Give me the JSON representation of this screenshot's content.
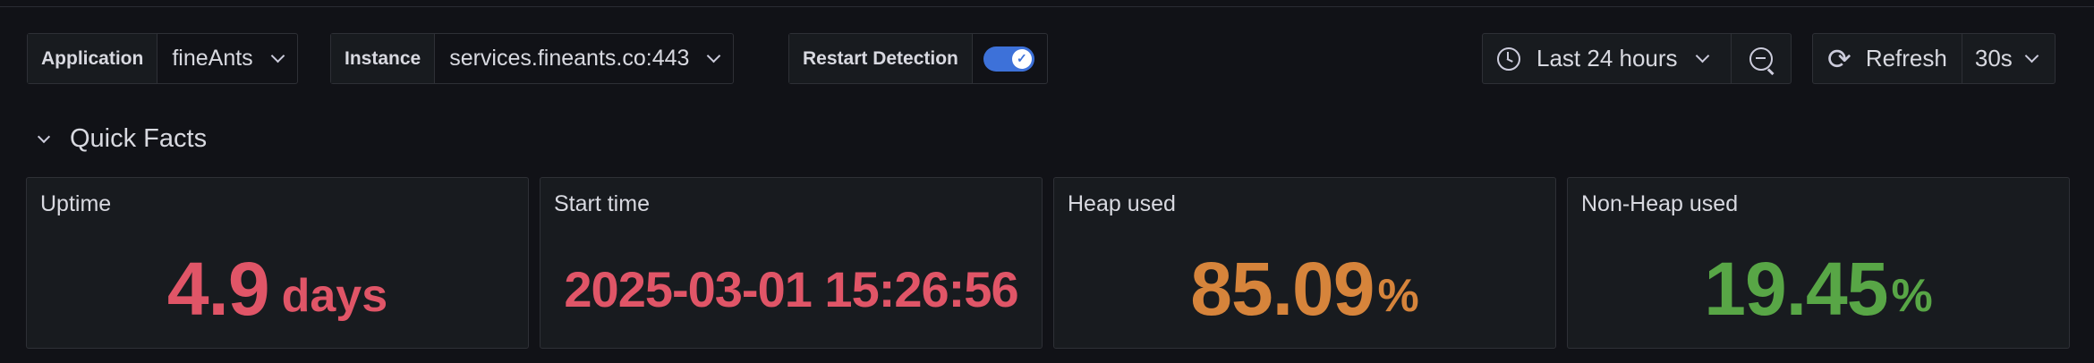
{
  "variables": {
    "application": {
      "label": "Application",
      "value": "fineAnts"
    },
    "instance": {
      "label": "Instance",
      "value": "services.fineants.co:443"
    },
    "restart_detection": {
      "label": "Restart Detection",
      "enabled": true
    }
  },
  "time_picker": {
    "range": "Last 24 hours"
  },
  "refresh": {
    "label": "Refresh",
    "interval": "30s"
  },
  "row": {
    "title": "Quick Facts",
    "collapsed": false
  },
  "panels": [
    {
      "title": "Uptime",
      "value": "4.9",
      "unit": "days",
      "color": "#e05567"
    },
    {
      "title": "Start time",
      "value": "2025-03-01 15:26:56",
      "unit": "",
      "color": "#e05567"
    },
    {
      "title": "Heap used",
      "value": "85.09",
      "unit": "%",
      "color": "#d6843b"
    },
    {
      "title": "Non-Heap used",
      "value": "19.45",
      "unit": "%",
      "color": "#58a646"
    }
  ],
  "colors": {
    "accent": "#3d71d9",
    "background": "#111217",
    "panel": "#181b1f"
  }
}
